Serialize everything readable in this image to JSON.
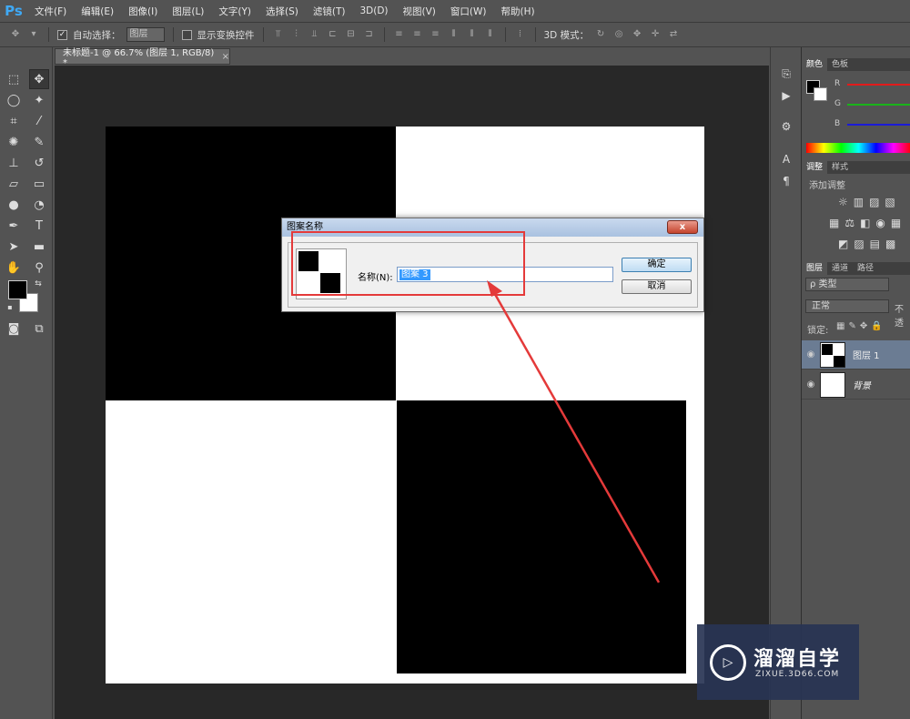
{
  "app": {
    "logo": "Ps"
  },
  "menu": [
    "文件(F)",
    "编辑(E)",
    "图像(I)",
    "图层(L)",
    "文字(Y)",
    "选择(S)",
    "滤镜(T)",
    "3D(D)",
    "视图(V)",
    "窗口(W)",
    "帮助(H)"
  ],
  "options": {
    "auto_select_label": "自动选择：",
    "auto_select_value": "图层",
    "show_transform_label": "显示变换控件",
    "mode_3d_label": "3D 模式："
  },
  "document_tab": {
    "title": "未标题-1 @ 66.7% (图层 1, RGB/8) *",
    "close": "×"
  },
  "dialog": {
    "title": "图案名称",
    "close": "x",
    "name_label": "名称(N):",
    "name_value": "图案 3",
    "ok_label": "确定",
    "cancel_label": "取消"
  },
  "color_panel": {
    "tabs": [
      "颜色",
      "色板"
    ],
    "channels": [
      "R",
      "G",
      "B"
    ],
    "colors": {
      "r": "#e21b1b",
      "g": "#19b319",
      "b": "#1b1bd8"
    }
  },
  "adjust_panel": {
    "tabs": [
      "调整",
      "样式"
    ],
    "add_label": "添加调整"
  },
  "layers_panel": {
    "tabs": [
      "图层",
      "通道",
      "路径"
    ],
    "filter_label": "ρ 类型",
    "blend_mode": "正常",
    "opacity_label": "不透",
    "lock_label": "锁定:",
    "layers": [
      {
        "name": "图层 1",
        "selected": true
      },
      {
        "name": "背景",
        "selected": false
      }
    ]
  },
  "watermark": {
    "title": "溜溜自学",
    "subtitle": "ZIXUE.3D66.COM"
  }
}
